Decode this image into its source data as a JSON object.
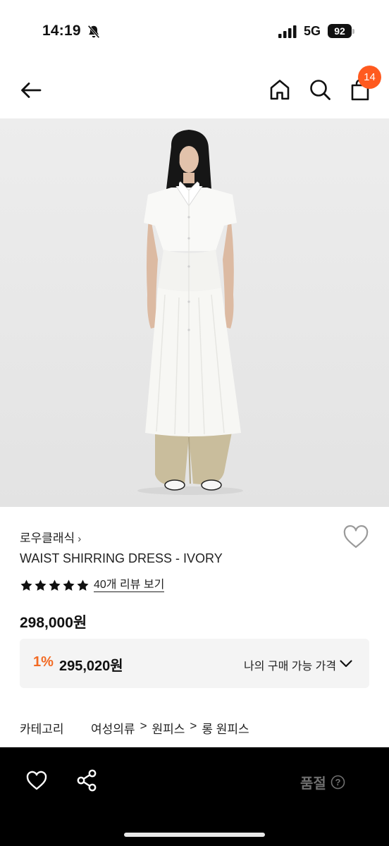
{
  "status_bar": {
    "time": "14:19",
    "network": "5G",
    "battery": "92"
  },
  "nav": {
    "cart_count": "14"
  },
  "product": {
    "brand": "로우클래식",
    "brand_chevron": "›",
    "name": "WAIST SHIRRING DRESS - IVORY",
    "rating_stars": 5,
    "review_link": "40개 리뷰 보기",
    "price": "298,000원",
    "discount": {
      "rate": "1%",
      "price": "295,020원",
      "label": "나의 구매 가능 가격"
    },
    "category": {
      "label": "카테고리",
      "path": [
        "여성의류",
        "원피스",
        "롱 원피스"
      ],
      "separator": ">"
    }
  },
  "bottom_bar": {
    "soldout_label": "품절"
  },
  "colors": {
    "accent": "#f26a23",
    "badge": "#ff5a1f",
    "bottom_bar_bg": "#000000",
    "discount_box_bg": "#f4f4f4"
  },
  "icons": [
    "bell-slash-icon",
    "signal-icon",
    "back-arrow-icon",
    "home-icon",
    "search-icon",
    "shopping-bag-icon",
    "heart-icon",
    "star-icon",
    "chevron-down-icon",
    "share-icon",
    "help-icon"
  ]
}
